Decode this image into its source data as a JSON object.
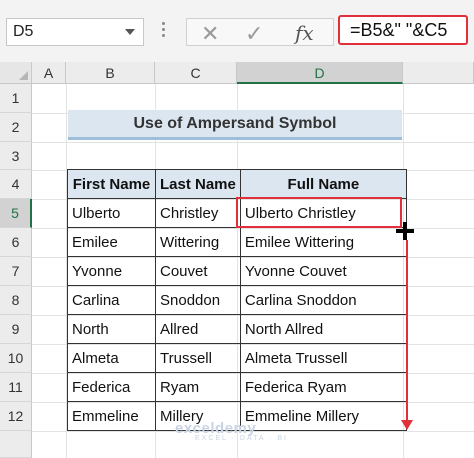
{
  "formula_bar": {
    "name_box": "D5",
    "formula": "=B5&\" \"&C5",
    "fx_label": "fx"
  },
  "columns": [
    "A",
    "B",
    "C",
    "D"
  ],
  "rows": [
    "1",
    "2",
    "3",
    "4",
    "5",
    "6",
    "7",
    "8",
    "9",
    "10",
    "11",
    "12"
  ],
  "title": "Use of Ampersand Symbol",
  "table": {
    "headers": [
      "First Name",
      "Last Name",
      "Full Name"
    ],
    "rows": [
      [
        "Ulberto",
        "Christley",
        "Ulberto Christley"
      ],
      [
        "Emilee",
        "Wittering",
        "Emilee Wittering"
      ],
      [
        "Yvonne",
        "Couvet",
        "Yvonne Couvet"
      ],
      [
        "Carlina",
        "Snoddon",
        "Carlina Snoddon"
      ],
      [
        "North",
        "Allred",
        "North Allred"
      ],
      [
        "Almeta",
        "Trussell",
        "Almeta Trussell"
      ],
      [
        "Federica",
        "Ryam",
        "Federica Ryam"
      ],
      [
        "Emmeline",
        "Millery",
        "Emmeline Millery"
      ]
    ]
  },
  "watermark": {
    "brand": "exceldemy",
    "tagline": "EXCEL · DATA · BI"
  },
  "colors": {
    "accent": "#e0303a",
    "header_fill": "#dce6f1",
    "active_header": "#217346"
  }
}
